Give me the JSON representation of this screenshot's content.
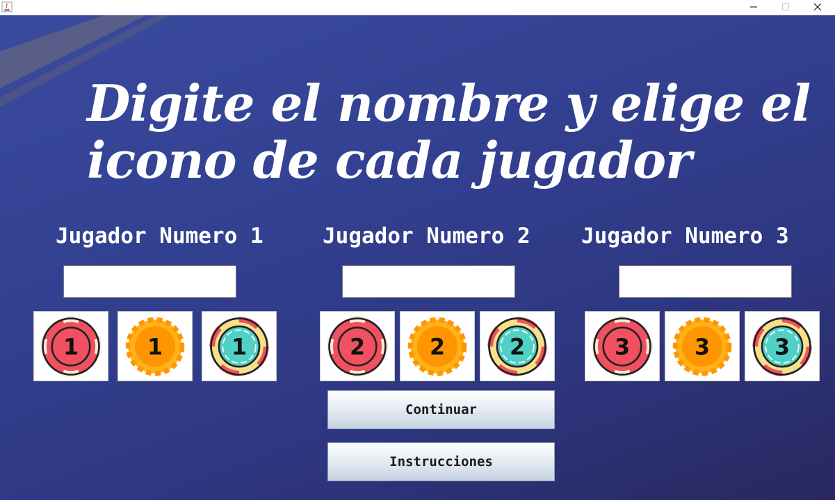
{
  "window": {
    "controls": {
      "minimize": "–",
      "maximize": "☐",
      "close": "✕"
    },
    "icon": "java-icon"
  },
  "heading": {
    "line1": "Digite el nombre y elige el",
    "line2": "icono de cada jugador"
  },
  "players": [
    {
      "label": "Jugador Numero 1",
      "name_value": "",
      "chips": [
        "1",
        "1",
        "1"
      ]
    },
    {
      "label": "Jugador Numero 2",
      "name_value": "",
      "chips": [
        "2",
        "2",
        "2"
      ]
    },
    {
      "label": "Jugador Numero 3",
      "name_value": "",
      "chips": [
        "3",
        "3",
        "3"
      ]
    }
  ],
  "chip_styles": [
    "red-chip",
    "orange-chip",
    "teal-chip"
  ],
  "buttons": {
    "continue_label": "Continuar",
    "instructions_label": "Instrucciones"
  },
  "colors": {
    "background_top": "#3a4a9e",
    "background_bottom": "#28285e",
    "red_chip": "#f0505f",
    "orange_chip": "#ff9500",
    "teal_chip": "#4fd1c5"
  }
}
